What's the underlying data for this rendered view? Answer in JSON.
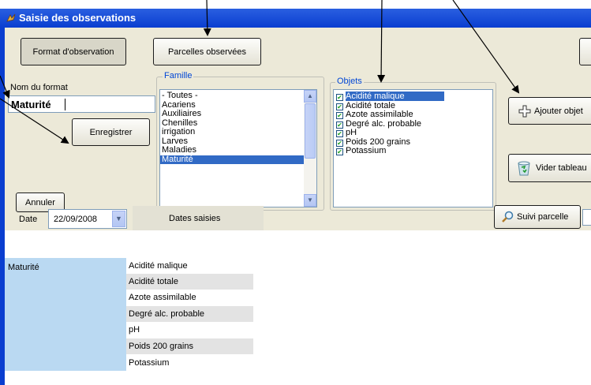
{
  "window": {
    "title": "Saisie des observations"
  },
  "toolbar": {
    "format_label": "Format d'observation",
    "parcelles_label": "Parcelles observées"
  },
  "format": {
    "label": "Nom du format",
    "value": "Maturité",
    "save_label": "Enregistrer",
    "cancel_label": "Annuler"
  },
  "famille": {
    "legend": "Famille",
    "items": [
      "- Toutes -",
      "Acariens",
      "Auxiliaires",
      "Chenilles",
      "irrigation",
      "Larves",
      "Maladies",
      "Maturité"
    ],
    "selected": "Maturité"
  },
  "objets": {
    "legend": "Objets",
    "items": [
      "Acidité malique",
      "Acidité totale",
      "Azote assimilable",
      "Degré alc. probable",
      "pH",
      "Poids 200 grains",
      "Potassium"
    ],
    "selected": "Acidité malique"
  },
  "actions": {
    "add_label": "Ajouter objet",
    "empty_label": "Vider tableau",
    "follow_label": "Suivi parcelle"
  },
  "date": {
    "label": "Date",
    "value": "22/09/2008",
    "dates_label": "Dates saisies"
  },
  "grid": {
    "group": "Maturité",
    "rows": [
      "Acidité malique",
      "Acidité totale",
      "Azote assimilable",
      "Degré alc. probable",
      "pH",
      "Poids 200 grains",
      "Potassium"
    ]
  }
}
